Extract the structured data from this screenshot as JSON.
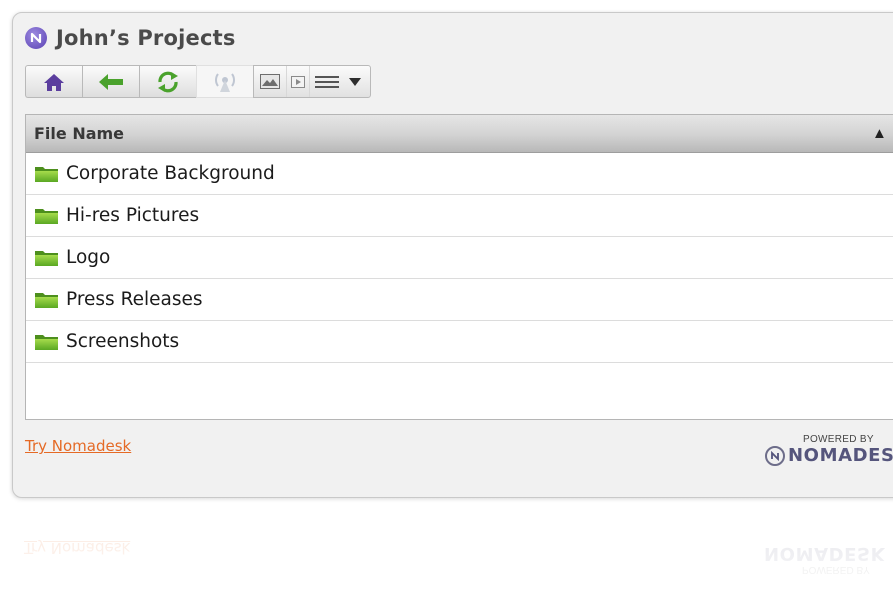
{
  "window": {
    "title": "John’s Projects"
  },
  "toolbar": {
    "icons": [
      "home-icon",
      "back-arrow-icon",
      "refresh-icon",
      "radar-icon",
      "thumbnail-view-icon",
      "slideshow-icon",
      "list-view-icon",
      "dropdown-arrow-icon"
    ]
  },
  "grid": {
    "column_header": "File Name",
    "sort_indicator": "▲",
    "rows": [
      {
        "name": "Corporate Background",
        "icon": "folder-icon"
      },
      {
        "name": "Hi-res Pictures",
        "icon": "folder-icon"
      },
      {
        "name": "Logo",
        "icon": "folder-icon"
      },
      {
        "name": "Press Releases",
        "icon": "folder-icon"
      },
      {
        "name": "Screenshots",
        "icon": "folder-icon"
      }
    ]
  },
  "footer": {
    "link_label": "Try Nomadesk",
    "powered_by": "POWERED BY",
    "brand": "NOMADESK"
  },
  "colors": {
    "link": "#e56a26",
    "folder": "#6cbf2a",
    "toolbar_green": "#4aa22c",
    "home_purple": "#5b3e9e",
    "brand": "#55557c"
  }
}
